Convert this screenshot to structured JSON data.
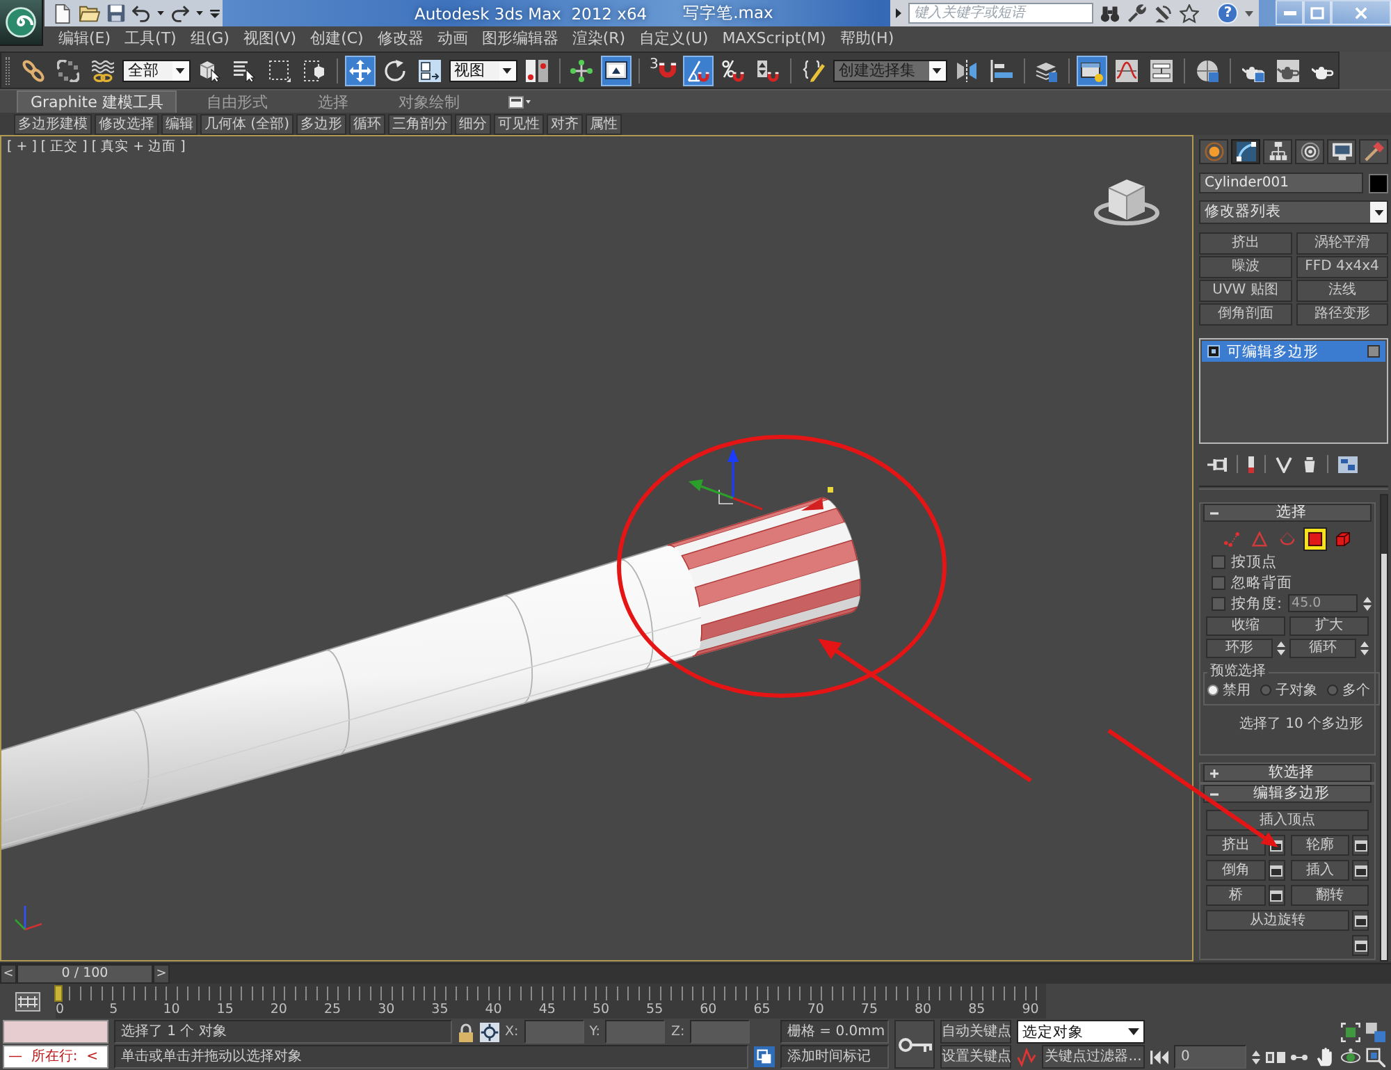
{
  "title_bar": {
    "app_title": "Autodesk 3ds Max  2012 x64",
    "file_name": "写字笔.max",
    "search": {
      "placeholder": "键入关键字或短语"
    },
    "help": "?"
  },
  "menu_bar": [
    "编辑(E)",
    "工具(T)",
    "组(G)",
    "视图(V)",
    "创建(C)",
    "修改器",
    "动画",
    "图形编辑器",
    "渲染(R)",
    "自定义(U)",
    "MAXScript(M)",
    "帮助(H)"
  ],
  "main_toolbar": [
    {
      "kind": "icon",
      "selected": false
    },
    {
      "kind": "icon",
      "selected": false
    },
    {
      "kind": "icon",
      "selected": false
    },
    {
      "kind": "dropdown",
      "value": "全部"
    },
    {
      "kind": "icon",
      "selected": false
    },
    {
      "kind": "icon",
      "selected": false
    },
    {
      "kind": "icon",
      "selected": false
    },
    {
      "kind": "icon",
      "selected": false
    },
    {
      "kind": "icon",
      "selected": true
    },
    {
      "kind": "icon",
      "selected": false
    },
    {
      "kind": "icon",
      "selected": false
    },
    {
      "kind": "dropdown",
      "value": "视图"
    },
    {
      "kind": "icon",
      "selected": false
    },
    {
      "kind": "icon",
      "selected": false
    },
    {
      "kind": "icon",
      "selected": true
    },
    {
      "kind": "icon",
      "selected": false,
      "label": "3"
    },
    {
      "kind": "icon",
      "selected": true
    },
    {
      "kind": "icon",
      "selected": false
    },
    {
      "kind": "icon",
      "selected": false
    },
    {
      "kind": "icon",
      "selected": false
    },
    {
      "kind": "dropdown",
      "placeholder": "创建选择集"
    },
    {
      "kind": "icon",
      "selected": false
    },
    {
      "kind": "icon",
      "selected": false
    },
    {
      "kind": "icon",
      "selected": false
    },
    {
      "kind": "icon",
      "selected": true
    },
    {
      "kind": "icon",
      "selected": false
    },
    {
      "kind": "icon",
      "selected": false
    },
    {
      "kind": "icon",
      "selected": false
    },
    {
      "kind": "icon",
      "selected": false
    },
    {
      "kind": "icon",
      "selected": false
    },
    {
      "kind": "icon",
      "selected": false
    }
  ],
  "ribbon": {
    "tabs": [
      {
        "label": "Graphite 建模工具",
        "selected": true
      },
      {
        "label": "自由形式",
        "selected": false
      },
      {
        "label": "选择",
        "selected": false
      },
      {
        "label": "对象绘制",
        "selected": false
      }
    ],
    "panels": [
      "多边形建模",
      "修改选择",
      "编辑",
      "几何体 (全部)",
      "多边形",
      "循环",
      "三角剖分",
      "细分",
      "可见性",
      "对齐",
      "属性"
    ]
  },
  "viewport": {
    "labels": [
      "[ + ]",
      "[ 正交 ]",
      "[ 真实 + 边面 ]"
    ]
  },
  "command_panel": {
    "tabs": [
      {
        "selected": false
      },
      {
        "selected": true
      },
      {
        "selected": false
      },
      {
        "selected": false
      },
      {
        "selected": false
      },
      {
        "selected": false
      }
    ],
    "object_name": "Cylinder001",
    "modifier_list": "修改器列表",
    "modifier_buttons": [
      "挤出",
      "涡轮平滑",
      "噪波",
      "FFD 4x4x4",
      "UVW 贴图",
      "法线",
      "倒角剖面",
      "路径变形"
    ],
    "modifier_stack": [
      {
        "label": "可编辑多边形",
        "selected": true
      }
    ],
    "selection_rollout": {
      "title": "选择",
      "expanded": true,
      "levels": [
        {
          "selected": false
        },
        {
          "selected": false
        },
        {
          "selected": false
        },
        {
          "selected": true
        },
        {
          "selected": false
        }
      ],
      "checkboxes": [
        {
          "label": "按顶点",
          "checked": false
        },
        {
          "label": "忽略背面",
          "checked": false
        },
        {
          "label": "按角度:",
          "checked": false,
          "field": {
            "value": "45.0",
            "disabled": true
          }
        }
      ],
      "buttons": [
        "收缩",
        "扩大"
      ],
      "spinner_buttons": [
        "环形",
        "循环"
      ],
      "preview": {
        "title": "预览选择",
        "options": [
          {
            "label": "禁用",
            "selected": true
          },
          {
            "label": "子对象",
            "selected": false
          },
          {
            "label": "多个",
            "selected": false
          }
        ]
      },
      "info": "选择了 10 个多边形"
    },
    "soft_selection_rollout": {
      "title": "软选择",
      "expanded": false
    },
    "edit_polygons_rollout": {
      "title": "编辑多边形",
      "expanded": true,
      "buttons": [
        {
          "kind": "wide",
          "label": "插入顶点",
          "settings": false
        },
        {
          "kind": "half",
          "label": "挤出",
          "settings": true
        },
        {
          "kind": "half",
          "label": "轮廓",
          "settings": true
        },
        {
          "kind": "half",
          "label": "倒角",
          "settings": true
        },
        {
          "kind": "half",
          "label": "插入",
          "settings": true
        },
        {
          "kind": "half",
          "label": "桥",
          "settings": true
        },
        {
          "kind": "half",
          "label": "翻转",
          "settings": false
        },
        {
          "kind": "wide",
          "label": "从边旋转",
          "settings": true
        },
        {
          "kind": "wide",
          "settings": true
        }
      ]
    }
  },
  "time_slider": {
    "prev": "<",
    "label": "0 / 100",
    "next": ">",
    "level": 0
  },
  "track_bar": {
    "ticks": [
      "0",
      "5",
      "10",
      "15",
      "20",
      "25",
      "30",
      "35",
      "40",
      "45",
      "50",
      "55",
      "60",
      "65",
      "70",
      "75",
      "80",
      "85",
      "90"
    ]
  },
  "status_bar": {
    "listener": "—  所在行:  <",
    "selection_info": "选择了 1 个 对象",
    "coordinates": [
      "X:",
      "Y:",
      "Z:"
    ],
    "prompt": "单击或单击并拖动以选择对象",
    "grid": "栅格 = 0.0mm",
    "time_tag": "添加时间标记"
  },
  "animation_controls": {
    "auto_key": "自动关键点",
    "set_key": "设置关键点",
    "key_mode": "选定对象",
    "key_filters": "关键点过滤器...",
    "frame": "0"
  }
}
